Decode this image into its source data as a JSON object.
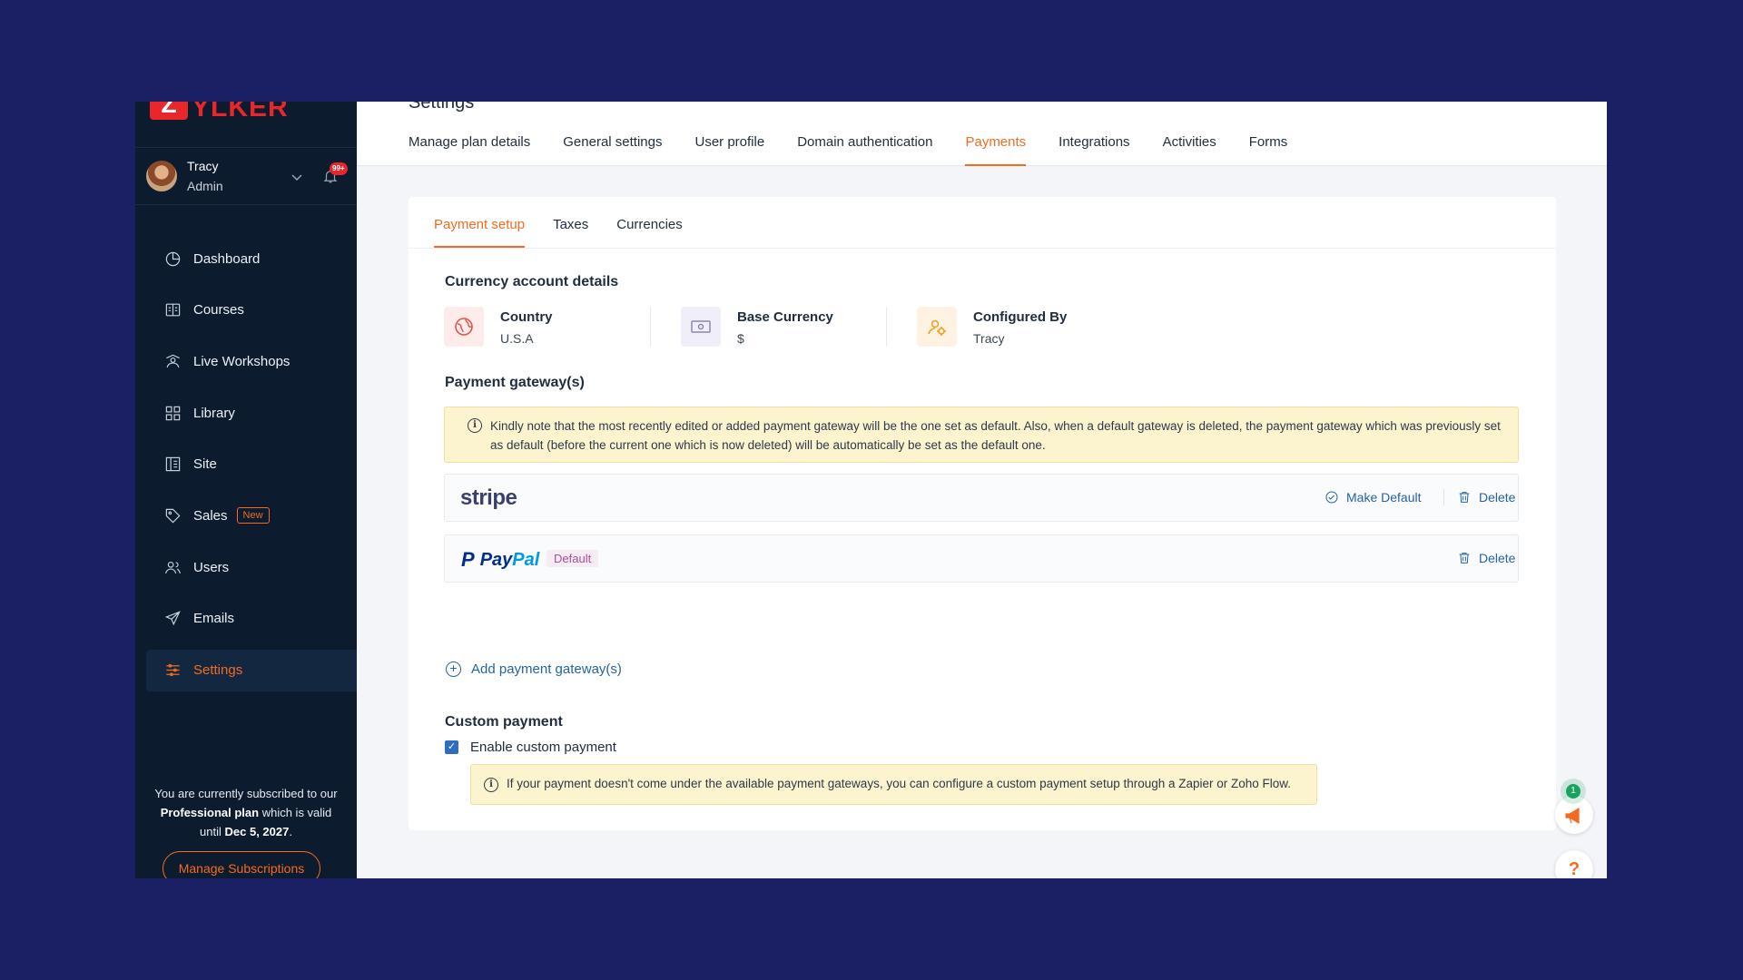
{
  "brand": {
    "badge": "Z",
    "name": "YLKER"
  },
  "profile": {
    "name": "Tracy",
    "role": "Admin",
    "notification_count": "99+"
  },
  "nav": [
    {
      "label": "Dashboard",
      "icon": "dashboard-icon"
    },
    {
      "label": "Courses",
      "icon": "courses-icon"
    },
    {
      "label": "Live Workshops",
      "icon": "workshops-icon"
    },
    {
      "label": "Library",
      "icon": "library-icon"
    },
    {
      "label": "Site",
      "icon": "site-icon"
    },
    {
      "label": "Sales",
      "icon": "tag-icon",
      "tag": "New"
    },
    {
      "label": "Users",
      "icon": "users-icon"
    },
    {
      "label": "Emails",
      "icon": "send-icon"
    },
    {
      "label": "Settings",
      "icon": "settings-icon",
      "active": true
    }
  ],
  "subscription": {
    "text_1": "You are currently subscribed to our",
    "plan": "Professional plan",
    "text_2": "which is valid until",
    "date": "Dec 5, 2027",
    "text_3": ".",
    "button": "Manage Subscriptions"
  },
  "page_title": "Settings",
  "tabs": [
    "Manage plan details",
    "General settings",
    "User profile",
    "Domain authentication",
    "Payments",
    "Integrations",
    "Activities",
    "Forms"
  ],
  "active_tab": "Payments",
  "subtabs": [
    "Payment setup",
    "Taxes",
    "Currencies"
  ],
  "active_subtab": "Payment setup",
  "currency_section": {
    "title": "Currency account details",
    "items": [
      {
        "label": "Country",
        "value": "U.S.A",
        "icon": "globe-icon"
      },
      {
        "label": "Base Currency",
        "value": "$",
        "icon": "money-icon"
      },
      {
        "label": "Configured By",
        "value": "Tracy",
        "icon": "user-gear-icon"
      }
    ]
  },
  "gateways_section": {
    "title": "Payment gateway(s)",
    "notice": "Kindly note that the most recently edited or added payment gateway will be the one set as default. Also, when a default gateway is deleted, the payment gateway which was previously set as default (before the current one which is now deleted) will be automatically be set as the default one.",
    "stripe": {
      "logo": "stripe",
      "make_default": "Make Default",
      "delete": "Delete"
    },
    "paypal": {
      "logo_a": "Pay",
      "logo_b": "Pal",
      "default_tag": "Default",
      "delete": "Delete"
    },
    "add_label": "Add payment gateway(s)"
  },
  "custom_payment": {
    "title": "Custom payment",
    "checkbox_label": "Enable custom payment",
    "checked": true,
    "notice": "If your payment doesn't come under the available payment gateways, you can configure a custom payment setup through a Zapier or Zoho Flow."
  },
  "floating": {
    "announce_count": "1",
    "help": "?"
  },
  "colors": {
    "accent": "#f36b21",
    "sidebar": "#0c1b2e",
    "link": "#2463a8",
    "background": "#1b1f63"
  }
}
